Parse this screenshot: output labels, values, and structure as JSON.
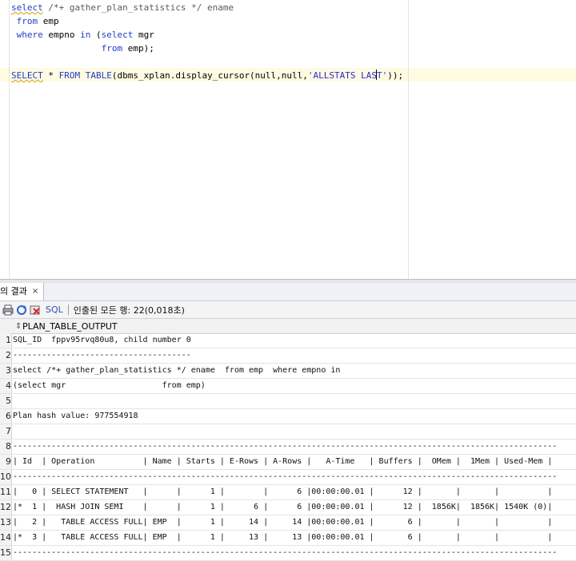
{
  "editor": {
    "lines": [
      {
        "kw1": "select",
        "rest": " /*+ gather_plan_statistics */ ename"
      },
      {
        "indent": " ",
        "kw1": "from",
        "rest": " emp"
      },
      {
        "indent": " ",
        "kw1": "where",
        "mid": " empno ",
        "kw2": "in",
        "mid2": " (",
        "kw3": "select",
        "rest": " mgr"
      },
      {
        "indent": "                 ",
        "kw1": "from",
        "rest": " emp);"
      },
      {
        "blank": ""
      },
      {
        "kw1": "SELECT",
        "mid": " * ",
        "kw2": "FROM",
        "mid2": " ",
        "kw3": "TABLE",
        "rest": "(dbms_xplan.display_cursor(null,null,",
        "str": "'ALLSTATS LAST'",
        "tail": "));"
      }
    ]
  },
  "results_tab": {
    "label": "의 결과",
    "close": "×"
  },
  "toolbar": {
    "sql_label": "SQL",
    "status": "인출된 모든 행: 22(0,018초)"
  },
  "grid": {
    "column": "PLAN_TABLE_OUTPUT",
    "rows": [
      {
        "n": "1",
        "text": "SQL_ID  fppv95rvq80u8, child number 0"
      },
      {
        "n": "2",
        "text": "-------------------------------------"
      },
      {
        "n": "3",
        "text": "select /*+ gather_plan_statistics */ ename  from emp  where empno in"
      },
      {
        "n": "4",
        "text": "(select mgr                    from emp)"
      },
      {
        "n": "5",
        "text": ""
      },
      {
        "n": "6",
        "text": "Plan hash value: 977554918"
      },
      {
        "n": "7",
        "text": ""
      },
      {
        "n": "8",
        "text": "-----------------------------------------------------------------------------------------------------------------"
      },
      {
        "n": "9",
        "text": "| Id  | Operation          | Name | Starts | E-Rows | A-Rows |   A-Time   | Buffers |  OMem |  1Mem | Used-Mem |"
      },
      {
        "n": "10",
        "text": "-----------------------------------------------------------------------------------------------------------------"
      },
      {
        "n": "11",
        "text": "|   0 | SELECT STATEMENT   |      |      1 |        |      6 |00:00:00.01 |      12 |       |       |          |"
      },
      {
        "n": "12",
        "text": "|*  1 |  HASH JOIN SEMI    |      |      1 |      6 |      6 |00:00:00.01 |      12 |  1856K|  1856K| 1540K (0)|"
      },
      {
        "n": "13",
        "text": "|   2 |   TABLE ACCESS FULL| EMP  |      1 |     14 |     14 |00:00:00.01 |       6 |       |       |          |"
      },
      {
        "n": "14",
        "text": "|*  3 |   TABLE ACCESS FULL| EMP  |      1 |     13 |     13 |00:00:00.01 |       6 |       |       |          |"
      },
      {
        "n": "15",
        "text": "-----------------------------------------------------------------------------------------------------------------"
      }
    ]
  }
}
